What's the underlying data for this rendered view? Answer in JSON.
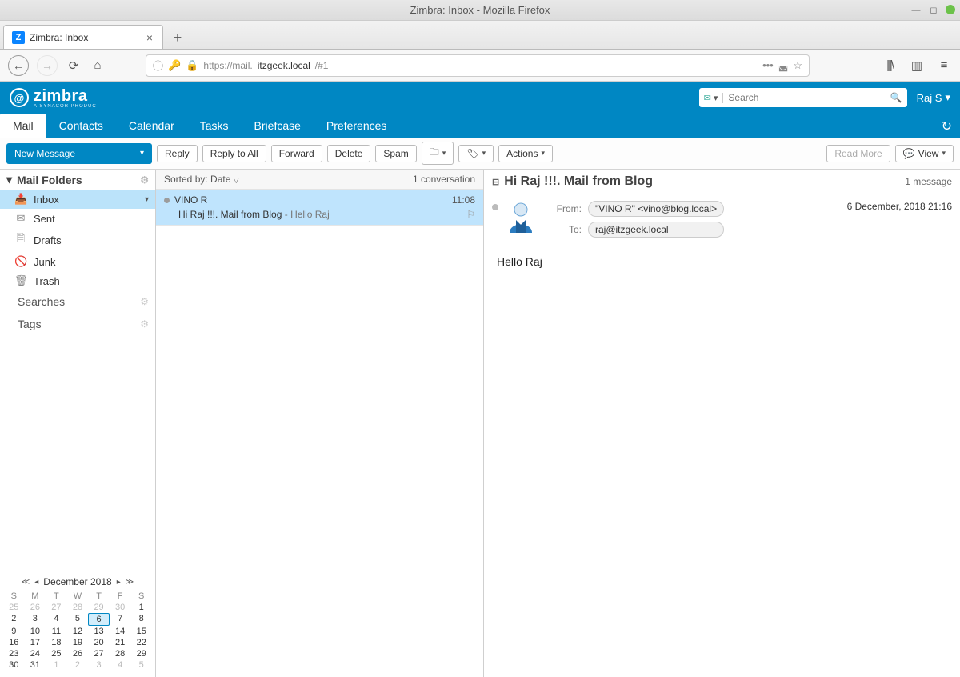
{
  "os": {
    "title": "Zimbra: Inbox - Mozilla Firefox"
  },
  "browser": {
    "tab_title": "Zimbra: Inbox",
    "favicon_letter": "Z",
    "url_prefix": "https://mail.",
    "url_domain": "itzgeek.local",
    "url_suffix": "/#1"
  },
  "header": {
    "brand": "zimbra",
    "sub": "A SYNACOR PRODUCT",
    "search_placeholder": "Search",
    "user": "Raj S"
  },
  "apptabs": [
    "Mail",
    "Contacts",
    "Calendar",
    "Tasks",
    "Briefcase",
    "Preferences"
  ],
  "compose_label": "New Message",
  "folders_header": "Mail Folders",
  "folders": [
    {
      "name": "Inbox",
      "icon": "📥",
      "selected": true,
      "expandable": true
    },
    {
      "name": "Sent",
      "icon": "✉"
    },
    {
      "name": "Drafts",
      "icon": "🗎"
    },
    {
      "name": "Junk",
      "icon": "🚫"
    },
    {
      "name": "Trash",
      "icon": "🗑"
    }
  ],
  "sections": {
    "searches": "Searches",
    "tags": "Tags"
  },
  "calendar": {
    "title": "December 2018",
    "dows": [
      "S",
      "M",
      "T",
      "W",
      "T",
      "F",
      "S"
    ],
    "rows": [
      [
        {
          "d": "25",
          "dim": true
        },
        {
          "d": "26",
          "dim": true
        },
        {
          "d": "27",
          "dim": true
        },
        {
          "d": "28",
          "dim": true
        },
        {
          "d": "29",
          "dim": true
        },
        {
          "d": "30",
          "dim": true
        },
        {
          "d": "1"
        }
      ],
      [
        {
          "d": "2"
        },
        {
          "d": "3"
        },
        {
          "d": "4"
        },
        {
          "d": "5"
        },
        {
          "d": "6",
          "today": true
        },
        {
          "d": "7"
        },
        {
          "d": "8"
        }
      ],
      [
        {
          "d": "9"
        },
        {
          "d": "10"
        },
        {
          "d": "11"
        },
        {
          "d": "12"
        },
        {
          "d": "13"
        },
        {
          "d": "14"
        },
        {
          "d": "15"
        }
      ],
      [
        {
          "d": "16"
        },
        {
          "d": "17"
        },
        {
          "d": "18"
        },
        {
          "d": "19"
        },
        {
          "d": "20"
        },
        {
          "d": "21"
        },
        {
          "d": "22"
        }
      ],
      [
        {
          "d": "23"
        },
        {
          "d": "24"
        },
        {
          "d": "25"
        },
        {
          "d": "26"
        },
        {
          "d": "27"
        },
        {
          "d": "28"
        },
        {
          "d": "29"
        }
      ],
      [
        {
          "d": "30"
        },
        {
          "d": "31"
        },
        {
          "d": "1",
          "dim": true
        },
        {
          "d": "2",
          "dim": true
        },
        {
          "d": "3",
          "dim": true
        },
        {
          "d": "4",
          "dim": true
        },
        {
          "d": "5",
          "dim": true
        }
      ]
    ]
  },
  "actions": {
    "reply": "Reply",
    "reply_all": "Reply to All",
    "forward": "Forward",
    "delete": "Delete",
    "spam": "Spam",
    "actions": "Actions",
    "read_more": "Read More",
    "view": "View"
  },
  "sort": {
    "label": "Sorted by: Date",
    "count": "1 conversation"
  },
  "conv": {
    "sender": "VINO R",
    "time": "11:08",
    "subject": "Hi Raj !!!. Mail from Blog",
    "snippet": "Hello Raj"
  },
  "reading": {
    "subject": "Hi Raj !!!. Mail from Blog",
    "msg_count": "1 message",
    "from_label": "From:",
    "from_value": "\"VINO R\" <vino@blog.local>",
    "to_label": "To:",
    "to_value": "raj@itzgeek.local",
    "date": "6 December, 2018 21:16",
    "body": "Hello Raj"
  }
}
